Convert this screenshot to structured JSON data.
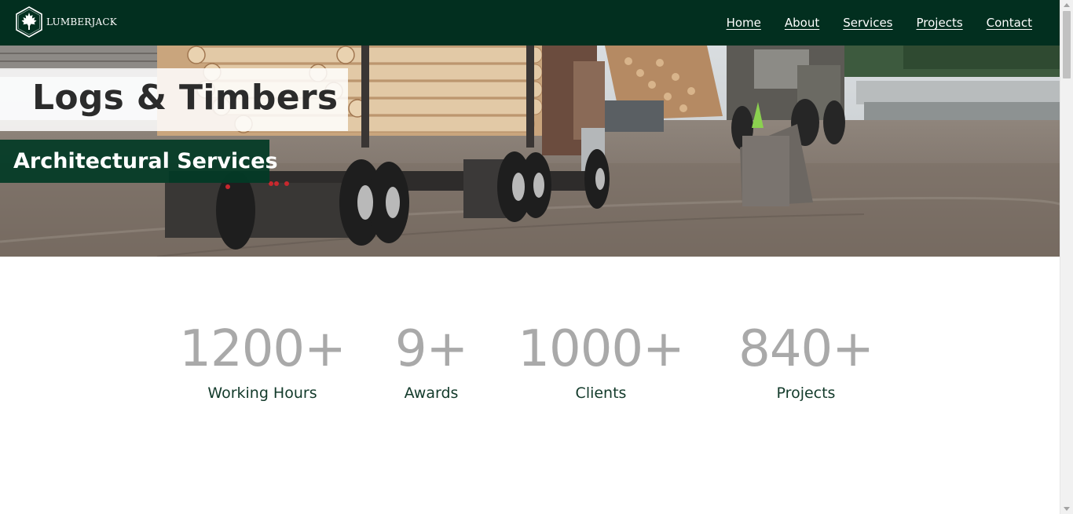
{
  "brand": {
    "name": "LUMBERJACK",
    "header_color": "#022f1f"
  },
  "nav": {
    "items": [
      {
        "label": "Home"
      },
      {
        "label": "About"
      },
      {
        "label": "Services"
      },
      {
        "label": "Projects"
      },
      {
        "label": "Contact"
      }
    ]
  },
  "hero": {
    "title": "Logs & Timbers",
    "subtitle": "Architectural Services"
  },
  "stats": [
    {
      "value": "1200+",
      "label": "Working Hours"
    },
    {
      "value": "9+",
      "label": "Awards"
    },
    {
      "value": "1000+",
      "label": "Clients"
    },
    {
      "value": "840+",
      "label": "Projects"
    }
  ],
  "colors": {
    "accent_dark_green": "#022f1f",
    "stat_number_gray": "#a9a9a9",
    "stat_label": "#123a2a"
  }
}
